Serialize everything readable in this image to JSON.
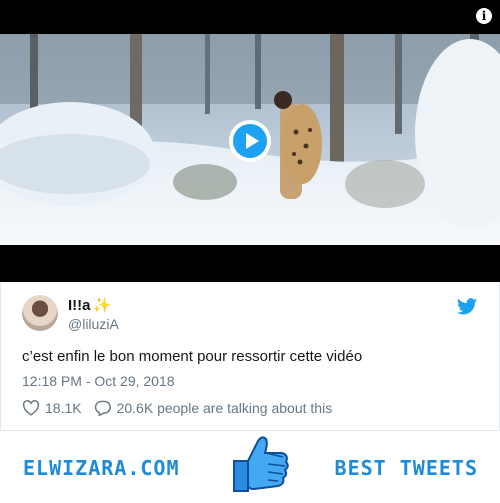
{
  "video": {
    "info_icon": "info-icon",
    "play_icon": "play-icon"
  },
  "tweet": {
    "author_name": "I!!a",
    "author_emoji": "✨",
    "handle": "@liluziA",
    "text": "c’est enfin le bon moment pour ressortir cette vidéo",
    "timestamp": "12:18 PM - Oct 29, 2018",
    "likes": "18.1K",
    "replies": "20.6K people are talking about this"
  },
  "footer": {
    "brand_left": "ELWIZARA.COM",
    "brand_right": "BEST TWEETS"
  },
  "colors": {
    "twitter_blue": "#1da1f2",
    "footer_blue": "#1e8bd9",
    "text_dark": "#14171a",
    "text_muted": "#657786"
  }
}
